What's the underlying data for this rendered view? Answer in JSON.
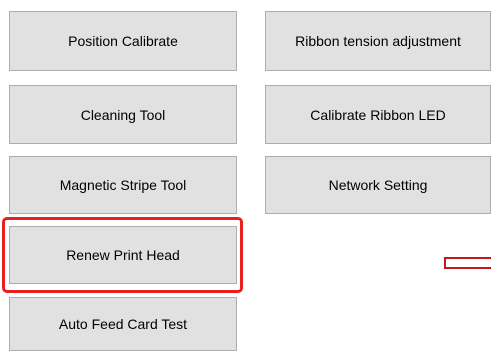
{
  "buttons": {
    "position_calibrate": "Position Calibrate",
    "ribbon_tension_adjustment": "Ribbon tension adjustment",
    "cleaning_tool": "Cleaning Tool",
    "calibrate_ribbon_led": "Calibrate Ribbon LED",
    "magnetic_stripe_tool": "Magnetic Stripe Tool",
    "network_setting": "Network Setting",
    "renew_print_head": "Renew Print Head",
    "auto_feed_card_test": "Auto Feed Card Test"
  },
  "colors": {
    "button_bg": "#e1e1e1",
    "button_border": "#adadad",
    "highlight": "#e8211f",
    "annotation": "#c0191f"
  }
}
